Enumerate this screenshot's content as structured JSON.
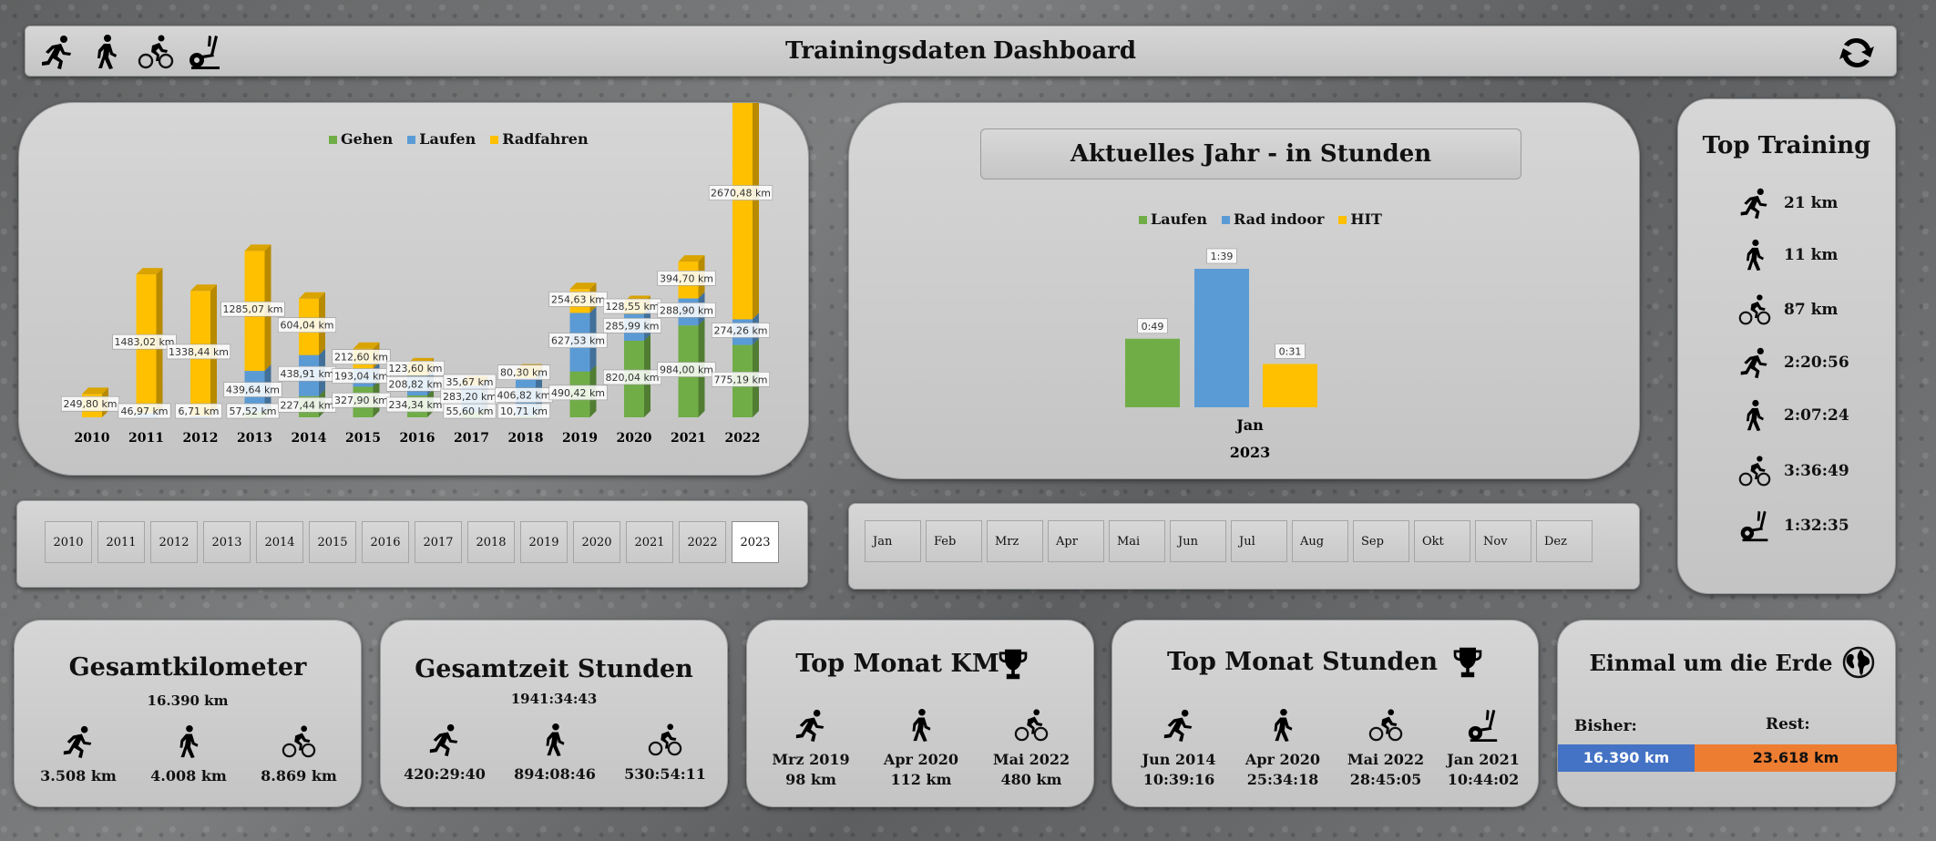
{
  "header": {
    "title": "Trainingsdaten Dashboard",
    "icons": [
      "running-icon",
      "walking-icon",
      "cycling-icon",
      "elliptical-icon"
    ]
  },
  "colors": {
    "green": "#70ad47",
    "blue": "#5b9bd5",
    "yellow": "#ffc000",
    "earth_done": "#4472c4",
    "earth_rest": "#ed7d31"
  },
  "chart_data": [
    {
      "type": "bar",
      "legend": [
        "Gehen",
        "Laufen",
        "Radfahren"
      ],
      "categories": [
        "2010",
        "2011",
        "2012",
        "2013",
        "2014",
        "2015",
        "2016",
        "2017",
        "2018",
        "2019",
        "2020",
        "2021",
        "2022"
      ],
      "series": [
        {
          "name": "Gehen",
          "values": [
            null,
            null,
            null,
            57.52,
            227.44,
            327.9,
            234.34,
            55.6,
            10.71,
            490.42,
            820.04,
            984.0,
            775.19
          ],
          "labels": [
            "",
            "",
            "",
            "57,52 km",
            "227,44 km",
            "327,90 km",
            "234,34 km",
            "55,60 km",
            "10,71 km",
            "490,42 km",
            "820,04 km",
            "984,00 km",
            "775,19 km"
          ]
        },
        {
          "name": "Laufen",
          "values": [
            null,
            46.97,
            6.71,
            439.64,
            438.91,
            193.04,
            208.82,
            283.2,
            406.82,
            627.53,
            285.99,
            288.9,
            274.26
          ],
          "labels": [
            "",
            "46,97 km",
            "6,71 km",
            "439,64 km",
            "438,91 km",
            "193,04 km",
            "208,82 km",
            "283,20 km",
            "406,82 km",
            "627,53 km",
            "285,99 km",
            "288,90 km",
            "274,26 km"
          ]
        },
        {
          "name": "Radfahren",
          "values": [
            249.8,
            1483.02,
            1338.44,
            1285.07,
            604.04,
            212.6,
            123.6,
            35.67,
            80.3,
            254.63,
            128.55,
            394.7,
            2670.48
          ],
          "labels": [
            "249,80 km",
            "1483,02 km",
            "1338,44 km",
            "1285,07 km",
            "604,04 km",
            "212,60 km",
            "123,60 km",
            "35,67 km",
            "80,30 km",
            "254,63 km",
            "128,55 km",
            "394,70 km",
            "2670,48 km"
          ]
        }
      ]
    },
    {
      "type": "bar",
      "title": "Aktuelles Jahr - in Stunden",
      "legend": [
        "Laufen",
        "Rad indoor",
        "HIT"
      ],
      "categories": [
        "Jan"
      ],
      "axis_group": "2023",
      "series": [
        {
          "name": "Laufen",
          "values": [
            0.8167
          ],
          "labels": [
            "0:49"
          ]
        },
        {
          "name": "Rad indoor",
          "values": [
            1.65
          ],
          "labels": [
            "1:39"
          ]
        },
        {
          "name": "HIT",
          "values": [
            0.5167
          ],
          "labels": [
            "0:31"
          ]
        }
      ]
    }
  ],
  "top_training": {
    "title": "Top Training",
    "rows": [
      {
        "icon": "running-icon",
        "value": "21 km"
      },
      {
        "icon": "walking-icon",
        "value": "11 km"
      },
      {
        "icon": "cycling-icon",
        "value": "87 km"
      },
      {
        "icon": "running-icon",
        "value": "2:20:56"
      },
      {
        "icon": "walking-icon",
        "value": "2:07:24"
      },
      {
        "icon": "cycling-icon",
        "value": "3:36:49"
      },
      {
        "icon": "elliptical-icon",
        "value": "1:32:35"
      }
    ]
  },
  "years": {
    "items": [
      "2010",
      "2011",
      "2012",
      "2013",
      "2014",
      "2015",
      "2016",
      "2017",
      "2018",
      "2019",
      "2020",
      "2021",
      "2022",
      "2023"
    ],
    "selected": "2023"
  },
  "months": {
    "items": [
      "Jan",
      "Feb",
      "Mrz",
      "Apr",
      "Mai",
      "Jun",
      "Jul",
      "Aug",
      "Sep",
      "Okt",
      "Nov",
      "Dez"
    ]
  },
  "gesamtkilometer": {
    "title": "Gesamtkilometer",
    "total": "16.390 km",
    "cols": [
      {
        "icon": "running-icon",
        "value": "3.508 km"
      },
      {
        "icon": "walking-icon",
        "value": "4.008 km"
      },
      {
        "icon": "cycling-icon",
        "value": "8.869 km"
      }
    ]
  },
  "gesamtzeit": {
    "title": "Gesamtzeit Stunden",
    "total": "1941:34:43",
    "cols": [
      {
        "icon": "running-icon",
        "value": "420:29:40"
      },
      {
        "icon": "walking-icon",
        "value": "894:08:46"
      },
      {
        "icon": "cycling-icon",
        "value": "530:54:11"
      }
    ]
  },
  "top_monat_km": {
    "title": "Top Monat KM",
    "cols": [
      {
        "icon": "running-icon",
        "month": "Mrz 2019",
        "value": "98 km"
      },
      {
        "icon": "walking-icon",
        "month": "Apr 2020",
        "value": "112 km"
      },
      {
        "icon": "cycling-icon",
        "month": "Mai 2022",
        "value": "480 km"
      }
    ]
  },
  "top_monat_stunden": {
    "title": "Top Monat Stunden",
    "cols": [
      {
        "icon": "running-icon",
        "month": "Jun 2014",
        "value": "10:39:16"
      },
      {
        "icon": "walking-icon",
        "month": "Apr 2020",
        "value": "25:34:18"
      },
      {
        "icon": "cycling-icon",
        "month": "Mai 2022",
        "value": "28:45:05"
      },
      {
        "icon": "elliptical-icon",
        "month": "Jan 2021",
        "value": "10:44:02"
      }
    ]
  },
  "erde": {
    "title": "Einmal um die Erde",
    "bisher_label": "Bisher:",
    "rest_label": "Rest:",
    "bisher": "16.390 km",
    "rest": "23.618 km",
    "progress": 0.41
  }
}
